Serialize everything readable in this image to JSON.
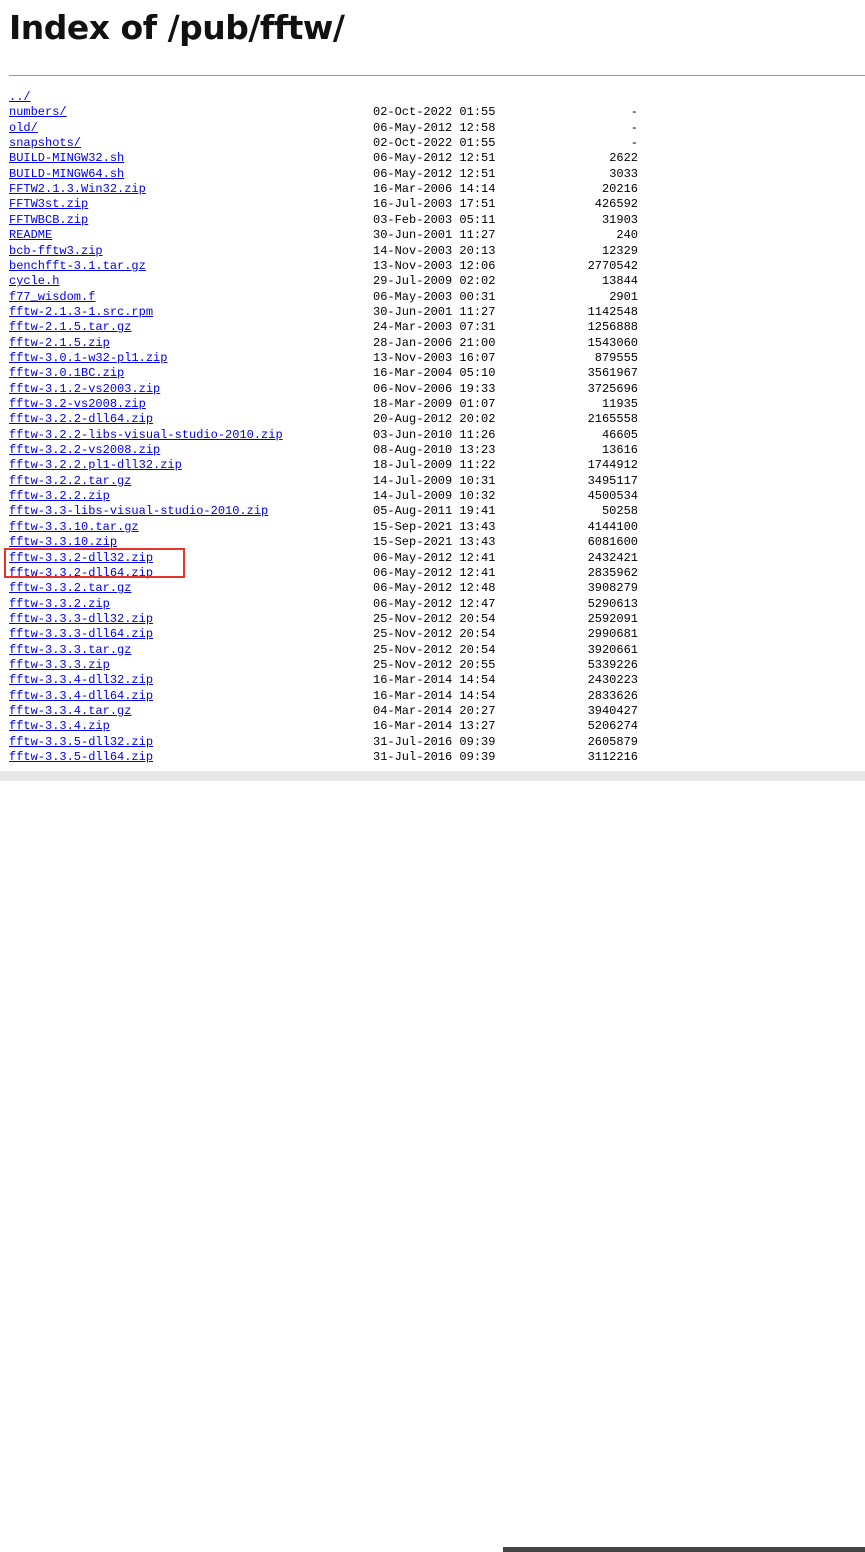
{
  "page": {
    "title": "Index of /pub/fftw/"
  },
  "highlight_color": "#e8332a",
  "link_color": "#0000ee",
  "entries": [
    {
      "name": "../",
      "date": "",
      "size": ""
    },
    {
      "name": "numbers/",
      "date": "02-Oct-2022 01:55",
      "size": "-"
    },
    {
      "name": "old/",
      "date": "06-May-2012 12:58",
      "size": "-"
    },
    {
      "name": "snapshots/",
      "date": "02-Oct-2022 01:55",
      "size": "-"
    },
    {
      "name": "BUILD-MINGW32.sh",
      "date": "06-May-2012 12:51",
      "size": "2622"
    },
    {
      "name": "BUILD-MINGW64.sh",
      "date": "06-May-2012 12:51",
      "size": "3033"
    },
    {
      "name": "FFTW2.1.3.Win32.zip",
      "date": "16-Mar-2006 14:14",
      "size": "20216"
    },
    {
      "name": "FFTW3st.zip",
      "date": "16-Jul-2003 17:51",
      "size": "426592"
    },
    {
      "name": "FFTWBCB.zip",
      "date": "03-Feb-2003 05:11",
      "size": "31903"
    },
    {
      "name": "README",
      "date": "30-Jun-2001 11:27",
      "size": "240"
    },
    {
      "name": "bcb-fftw3.zip",
      "date": "14-Nov-2003 20:13",
      "size": "12329"
    },
    {
      "name": "benchfft-3.1.tar.gz",
      "date": "13-Nov-2003 12:06",
      "size": "2770542"
    },
    {
      "name": "cycle.h",
      "date": "29-Jul-2009 02:02",
      "size": "13844"
    },
    {
      "name": "f77_wisdom.f",
      "date": "06-May-2003 00:31",
      "size": "2901"
    },
    {
      "name": "fftw-2.1.3-1.src.rpm",
      "date": "30-Jun-2001 11:27",
      "size": "1142548"
    },
    {
      "name": "fftw-2.1.5.tar.gz",
      "date": "24-Mar-2003 07:31",
      "size": "1256888"
    },
    {
      "name": "fftw-2.1.5.zip",
      "date": "28-Jan-2006 21:00",
      "size": "1543060"
    },
    {
      "name": "fftw-3.0.1-w32-pl1.zip",
      "date": "13-Nov-2003 16:07",
      "size": "879555"
    },
    {
      "name": "fftw-3.0.1BC.zip",
      "date": "16-Mar-2004 05:10",
      "size": "3561967"
    },
    {
      "name": "fftw-3.1.2-vs2003.zip",
      "date": "06-Nov-2006 19:33",
      "size": "3725696"
    },
    {
      "name": "fftw-3.2-vs2008.zip",
      "date": "18-Mar-2009 01:07",
      "size": "11935"
    },
    {
      "name": "fftw-3.2.2-dll64.zip",
      "date": "20-Aug-2012 20:02",
      "size": "2165558"
    },
    {
      "name": "fftw-3.2.2-libs-visual-studio-2010.zip",
      "date": "03-Jun-2010 11:26",
      "size": "46605"
    },
    {
      "name": "fftw-3.2.2-vs2008.zip",
      "date": "08-Aug-2010 13:23",
      "size": "13616"
    },
    {
      "name": "fftw-3.2.2.pl1-dll32.zip",
      "date": "18-Jul-2009 11:22",
      "size": "1744912"
    },
    {
      "name": "fftw-3.2.2.tar.gz",
      "date": "14-Jul-2009 10:31",
      "size": "3495117"
    },
    {
      "name": "fftw-3.2.2.zip",
      "date": "14-Jul-2009 10:32",
      "size": "4500534"
    },
    {
      "name": "fftw-3.3-libs-visual-studio-2010.zip",
      "date": "05-Aug-2011 19:41",
      "size": "50258"
    },
    {
      "name": "fftw-3.3.10.tar.gz",
      "date": "15-Sep-2021 13:43",
      "size": "4144100"
    },
    {
      "name": "fftw-3.3.10.zip",
      "date": "15-Sep-2021 13:43",
      "size": "6081600"
    },
    {
      "name": "fftw-3.3.2-dll32.zip",
      "date": "06-May-2012 12:41",
      "size": "2432421"
    },
    {
      "name": "fftw-3.3.2-dll64.zip",
      "date": "06-May-2012 12:41",
      "size": "2835962"
    },
    {
      "name": "fftw-3.3.2.tar.gz",
      "date": "06-May-2012 12:48",
      "size": "3908279"
    },
    {
      "name": "fftw-3.3.2.zip",
      "date": "06-May-2012 12:47",
      "size": "5290613"
    },
    {
      "name": "fftw-3.3.3-dll32.zip",
      "date": "25-Nov-2012 20:54",
      "size": "2592091"
    },
    {
      "name": "fftw-3.3.3-dll64.zip",
      "date": "25-Nov-2012 20:54",
      "size": "2990681"
    },
    {
      "name": "fftw-3.3.3.tar.gz",
      "date": "25-Nov-2012 20:54",
      "size": "3920661"
    },
    {
      "name": "fftw-3.3.3.zip",
      "date": "25-Nov-2012 20:55",
      "size": "5339226"
    },
    {
      "name": "fftw-3.3.4-dll32.zip",
      "date": "16-Mar-2014 14:54",
      "size": "2430223"
    },
    {
      "name": "fftw-3.3.4-dll64.zip",
      "date": "16-Mar-2014 14:54",
      "size": "2833626"
    },
    {
      "name": "fftw-3.3.4.tar.gz",
      "date": "04-Mar-2014 20:27",
      "size": "3940427"
    },
    {
      "name": "fftw-3.3.4.zip",
      "date": "16-Mar-2014 13:27",
      "size": "5206274"
    },
    {
      "name": "fftw-3.3.5-dll32.zip",
      "date": "31-Jul-2016 09:39",
      "size": "2605879"
    },
    {
      "name": "fftw-3.3.5-dll64.zip",
      "date": "31-Jul-2016 09:39",
      "size": "3112216"
    }
  ]
}
